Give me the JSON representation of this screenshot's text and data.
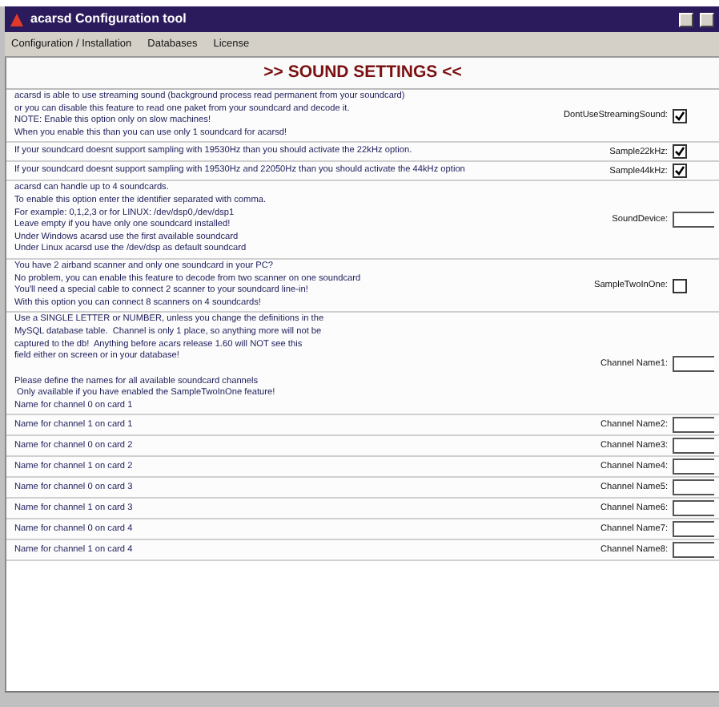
{
  "window": {
    "title": "acarsd Configuration tool"
  },
  "menu": [
    {
      "label": "Configuration / Installation"
    },
    {
      "label": "Databases"
    },
    {
      "label": "License"
    }
  ],
  "heading": ">> SOUND SETTINGS <<",
  "settings": [
    {
      "kind": "checkbox",
      "description": [
        "acarsd is able to use streaming sound (background process read permanent from your soundcard)",
        "or you can disable this feature to read one paket from your soundcard and decode it.",
        "NOTE: Enable this option only on slow machines!",
        "When you enable this than you can use only 1 soundcard for acarsd!"
      ],
      "label": "DontUseStreamingSound:",
      "checked": true
    },
    {
      "kind": "checkbox",
      "description": [
        "If your soundcard doesnt support sampling with 19530Hz than you should activate the 22kHz option."
      ],
      "label": "Sample22kHz:",
      "checked": true
    },
    {
      "kind": "checkbox",
      "description": [
        "If your soundcard doesnt support sampling with 19530Hz and 22050Hz than you should activate the 44kHz option"
      ],
      "label": "Sample44kHz:",
      "checked": true
    },
    {
      "kind": "text",
      "description": [
        "acarsd can handle up to 4 soundcards.",
        "To enable this option enter the identifier separated with comma.",
        "For example: 0,1,2,3 or for LINUX: /dev/dsp0,/dev/dsp1",
        "Leave empty if you have only one soundcard installed!",
        "Under Windows acarsd use the first available soundcard",
        "Under Linux acarsd use the /dev/dsp as default soundcard"
      ],
      "label": "SoundDevice:"
    },
    {
      "kind": "checkbox",
      "description": [
        "You have 2 airband scanner and only one soundcard in your PC?",
        "No problem, you can enable this feature to decode from two scanner on one soundcard",
        "You'll need a special cable to connect 2 scanner to your soundcard line-in!",
        "With this option you can connect 8 scanners on 4 soundcards!"
      ],
      "label": "SampleTwoInOne:",
      "checked": false
    },
    {
      "kind": "text",
      "description": [
        "Use a SINGLE LETTER or NUMBER, unless you change the definitions in the",
        "MySQL database table.  Channel is only 1 place, so anything more will not be",
        "captured to the db!  Anything before acars release 1.60 will NOT see this",
        "field either on screen or in your database!"
      ],
      "note": [
        "Please define the names for all available soundcard channels",
        " Only available if you have enabled the SampleTwoInOne feature!",
        "Name for channel 0 on card 1"
      ],
      "label": "Channel Name1:"
    },
    {
      "kind": "text",
      "description": [
        "Name for channel 1 on card 1"
      ],
      "label": "Channel Name2:"
    },
    {
      "kind": "text",
      "description": [
        "Name for channel 0 on card 2"
      ],
      "label": "Channel Name3:"
    },
    {
      "kind": "text",
      "description": [
        "Name for channel 1 on card 2"
      ],
      "label": "Channel Name4:"
    },
    {
      "kind": "text",
      "description": [
        "Name for channel 0 on card 3"
      ],
      "label": "Channel Name5:"
    },
    {
      "kind": "text",
      "description": [
        "Name for channel 1 on card 3"
      ],
      "label": "Channel Name6:"
    },
    {
      "kind": "text",
      "description": [
        "Name for channel 0 on card 4"
      ],
      "label": "Channel Name7:"
    },
    {
      "kind": "text",
      "description": [
        "Name for channel 1 on card 4"
      ],
      "label": "Channel Name8:"
    }
  ]
}
